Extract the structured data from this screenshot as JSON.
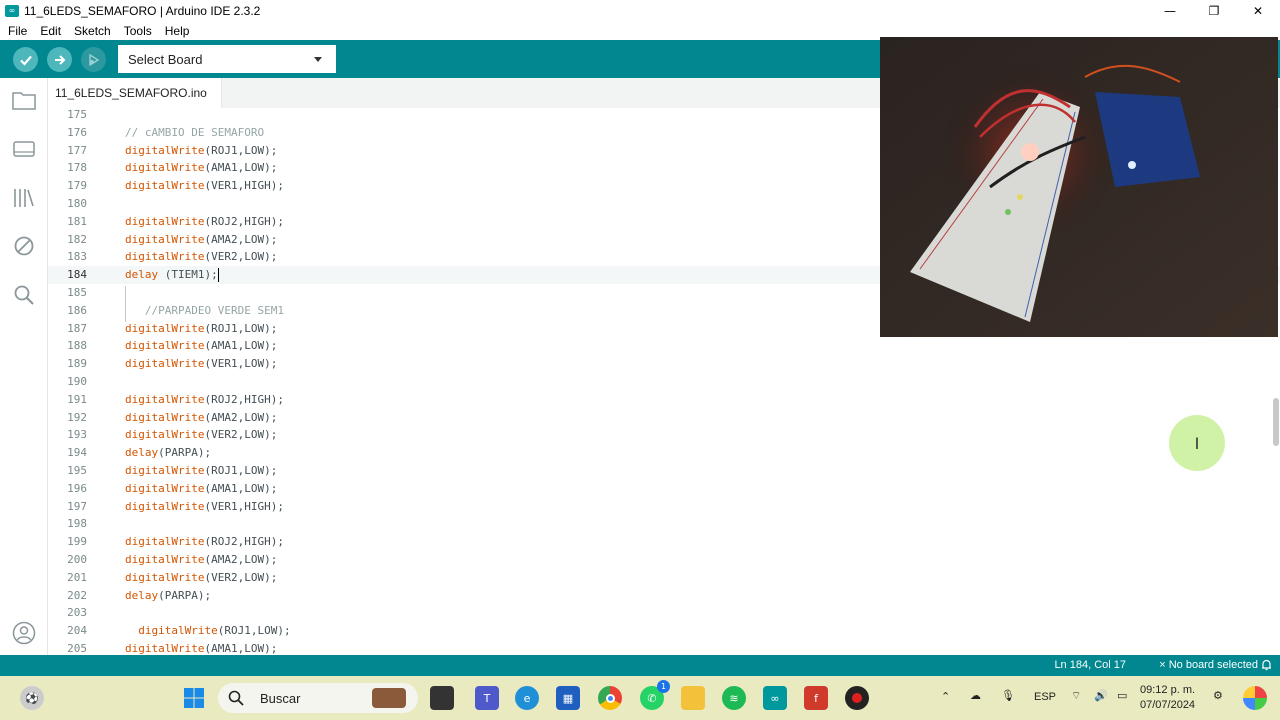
{
  "window": {
    "title": "11_6LEDS_SEMAFORO | Arduino IDE 2.3.2",
    "app_icon_glyph": "∞",
    "controls": [
      "—",
      "❐",
      "✕"
    ]
  },
  "menu": [
    "File",
    "Edit",
    "Sketch",
    "Tools",
    "Help"
  ],
  "toolbar": {
    "verify_icon": "check-icon",
    "upload_icon": "arrow-right-icon",
    "debug_icon": "debug-icon",
    "board_select_label": "Select Board"
  },
  "sidebar": {
    "icons": [
      "folder-icon",
      "board-icon",
      "library-icon",
      "no-entry-icon",
      "search-icon",
      "account-icon"
    ]
  },
  "tabs": [
    {
      "label": "11_6LEDS_SEMAFORO.ino"
    }
  ],
  "editor": {
    "current_line": 184,
    "lines": [
      {
        "n": "175",
        "code": ""
      },
      {
        "n": "176",
        "code": "// cAMBIO DE SEMAFORO",
        "type": "comment"
      },
      {
        "n": "177",
        "fn": "digitalWrite",
        "args": "(ROJ1,LOW);"
      },
      {
        "n": "178",
        "fn": "digitalWrite",
        "args": "(AMA1,LOW);"
      },
      {
        "n": "179",
        "fn": "digitalWrite",
        "args": "(VER1,HIGH);"
      },
      {
        "n": "180",
        "code": ""
      },
      {
        "n": "181",
        "fn": "digitalWrite",
        "args": "(ROJ2,HIGH);"
      },
      {
        "n": "182",
        "fn": "digitalWrite",
        "args": "(AMA2,LOW);"
      },
      {
        "n": "183",
        "fn": "digitalWrite",
        "args": "(VER2,LOW);"
      },
      {
        "n": "184",
        "fn": "delay",
        "args": " (TIEM1);",
        "current": true
      },
      {
        "n": "185",
        "code": ""
      },
      {
        "n": "186",
        "code": "   //PARPADEO VERDE SEM1",
        "type": "comment"
      },
      {
        "n": "187",
        "fn": "digitalWrite",
        "args": "(ROJ1,LOW);"
      },
      {
        "n": "188",
        "fn": "digitalWrite",
        "args": "(AMA1,LOW);"
      },
      {
        "n": "189",
        "fn": "digitalWrite",
        "args": "(VER1,LOW);"
      },
      {
        "n": "190",
        "code": ""
      },
      {
        "n": "191",
        "fn": "digitalWrite",
        "args": "(ROJ2,HIGH);"
      },
      {
        "n": "192",
        "fn": "digitalWrite",
        "args": "(AMA2,LOW);"
      },
      {
        "n": "193",
        "fn": "digitalWrite",
        "args": "(VER2,LOW);"
      },
      {
        "n": "194",
        "fn": "delay",
        "args": "(PARPA);"
      },
      {
        "n": "195",
        "fn": "digitalWrite",
        "args": "(ROJ1,LOW);"
      },
      {
        "n": "196",
        "fn": "digitalWrite",
        "args": "(AMA1,LOW);"
      },
      {
        "n": "197",
        "fn": "digitalWrite",
        "args": "(VER1,HIGH);"
      },
      {
        "n": "198",
        "code": ""
      },
      {
        "n": "199",
        "fn": "digitalWrite",
        "args": "(ROJ2,HIGH);"
      },
      {
        "n": "200",
        "fn": "digitalWrite",
        "args": "(AMA2,LOW);"
      },
      {
        "n": "201",
        "fn": "digitalWrite",
        "args": "(VER2,LOW);"
      },
      {
        "n": "202",
        "fn": "delay",
        "args": "(PARPA);"
      },
      {
        "n": "203",
        "code": ""
      },
      {
        "n": "204",
        "fn": "  digitalWrite",
        "args": "(ROJ1,LOW);"
      },
      {
        "n": "205",
        "fn": "digitalWrite",
        "args": "(AMA1,LOW);"
      }
    ]
  },
  "statusbar": {
    "position": "Ln 184, Col 17",
    "board": "× No board selected",
    "bell_icon": "bell-icon"
  },
  "taskbar": {
    "search_placeholder": "Buscar",
    "language": "ESP",
    "time": "09:12 p. m.",
    "date": "07/07/2024",
    "apps": [
      "windows-start-icon",
      "search-icon",
      "widgets-icon",
      "task-view-icon",
      "teams-icon",
      "edge-icon",
      "store-icon",
      "chrome-icon",
      "whatsapp-icon",
      "file-explorer-icon",
      "spotify-icon",
      "arduino-icon",
      "foxit-icon",
      "obs-record-icon"
    ],
    "whatsapp_badge": "1"
  },
  "colors": {
    "teal": "#00878f",
    "keyword": "#d35400",
    "comment": "#95a5a6",
    "text": "#434f54"
  }
}
